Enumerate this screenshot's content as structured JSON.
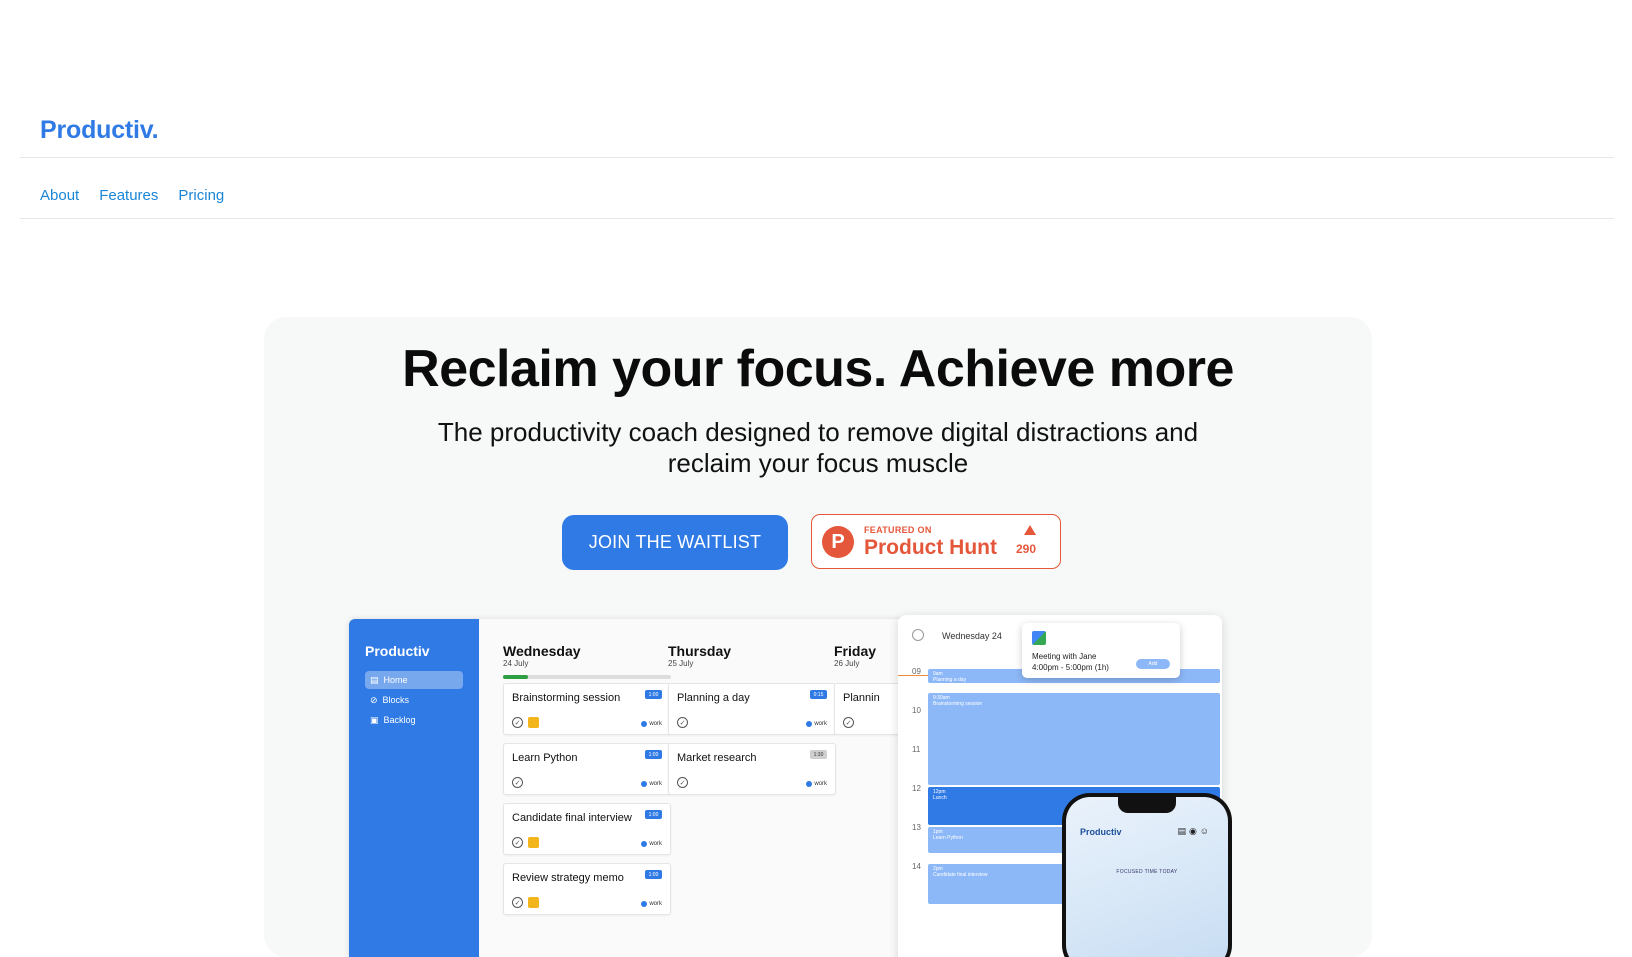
{
  "header": {
    "logo": "Productiv.",
    "nav": [
      "About",
      "Features",
      "Pricing"
    ]
  },
  "hero": {
    "title": "Reclaim your focus. Achieve more",
    "subtitle": "The productivity coach designed to remove digital distractions and reclaim your focus muscle",
    "cta_label": "JOIN THE WAITLIST",
    "product_hunt": {
      "featured_label": "FEATURED ON",
      "name": "Product Hunt",
      "logo_letter": "P",
      "count": "290"
    }
  },
  "app_preview": {
    "brand": "Productiv",
    "sidebar": [
      {
        "label": "Home",
        "icon": "home-icon"
      },
      {
        "label": "Blocks",
        "icon": "block-icon"
      },
      {
        "label": "Backlog",
        "icon": "folder-icon"
      }
    ],
    "days": [
      {
        "name": "Wednesday",
        "date": "24 July"
      },
      {
        "name": "Thursday",
        "date": "25 July"
      },
      {
        "name": "Friday",
        "date": "26 July"
      }
    ],
    "progress_fraction": 0.15,
    "cards": [
      {
        "title": "Brainstorming session",
        "badge": "1:00",
        "tag": "work",
        "flag": true
      },
      {
        "title": "Learn Python",
        "badge": "1:00",
        "tag": "work",
        "flag": false
      },
      {
        "title": "Candidate final interview",
        "badge": "1:00",
        "tag": "work",
        "flag": true
      },
      {
        "title": "Review strategy memo",
        "badge": "1:00",
        "tag": "work",
        "flag": true
      },
      {
        "title": "Planning a day",
        "badge": "0:15",
        "tag": "work",
        "flag": false
      },
      {
        "title": "Market research",
        "badge": "1:30",
        "tag": "work",
        "flag": false
      },
      {
        "title": "Plannin",
        "badge": "",
        "tag": "",
        "flag": false
      }
    ],
    "calendar": {
      "title": "Wednesday 24",
      "hours": [
        "09",
        "10",
        "11",
        "12",
        "13",
        "14"
      ],
      "events": [
        {
          "label": "9am\nPlanning a day"
        },
        {
          "label": "9:30am\nBrainstorming session"
        },
        {
          "label": "12pm\nLunch"
        },
        {
          "label": "1pm\nLearn Python"
        },
        {
          "label": "2pm\nCandidate final interview"
        }
      ],
      "popup": {
        "line1": "Meeting with Jane",
        "line2": "4:00pm - 5:00pm (1h)",
        "button": "Add"
      }
    },
    "phone": {
      "brand": "Productiv",
      "focus_label": "FOCUSED TIME TODAY"
    }
  }
}
